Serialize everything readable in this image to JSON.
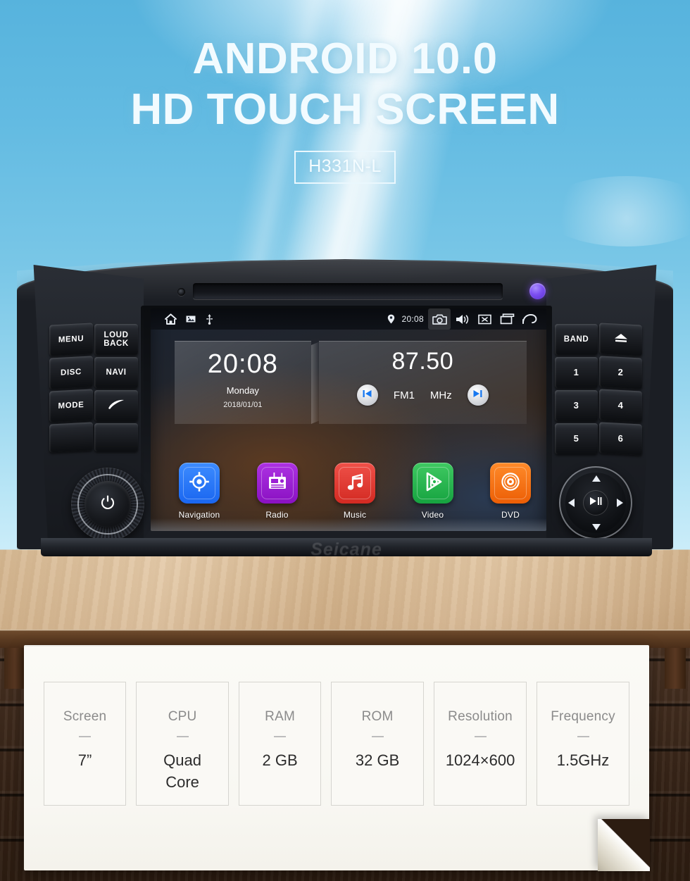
{
  "hero": {
    "line1": "ANDROID 10.0",
    "line2": "HD TOUCH SCREEN",
    "model_badge": "H331N-L"
  },
  "device": {
    "brand": "Seicane",
    "left_buttons": [
      {
        "label": "MENU",
        "name": "menu-button"
      },
      {
        "label": "LOUD\nBACK",
        "name": "loud-back-button"
      },
      {
        "label": "DISC",
        "name": "disc-button"
      },
      {
        "label": "NAVI",
        "name": "navi-button"
      },
      {
        "label": "MODE",
        "name": "mode-button"
      },
      {
        "label": "",
        "name": "phone-button"
      },
      {
        "label": "",
        "name": "blank-button-1"
      },
      {
        "label": "",
        "name": "blank-button-2"
      }
    ],
    "right_buttons": [
      {
        "label": "BAND",
        "name": "band-button"
      },
      {
        "label": "",
        "name": "eject-button"
      },
      {
        "label": "1",
        "name": "preset-1-button"
      },
      {
        "label": "2",
        "name": "preset-2-button"
      },
      {
        "label": "3",
        "name": "preset-3-button"
      },
      {
        "label": "4",
        "name": "preset-4-button"
      },
      {
        "label": "5",
        "name": "preset-5-button"
      },
      {
        "label": "6",
        "name": "preset-6-button"
      }
    ],
    "knob_icon": "power-icon",
    "dpad_center_icon": "play-pause-icon"
  },
  "screen": {
    "statusbar": {
      "left_icons": [
        "home-icon",
        "gallery-icon",
        "usb-icon"
      ],
      "location_icon": "location-pin-icon",
      "time": "20:08",
      "right_icons": [
        "camera-icon",
        "volume-icon",
        "close-box-icon",
        "recents-icon",
        "back-icon"
      ],
      "active_icon": "camera-icon"
    },
    "clock_widget": {
      "time": "20:08",
      "weekday": "Monday",
      "date": "2018/01/01"
    },
    "radio_widget": {
      "frequency": "87.50",
      "band": "FM1",
      "unit": "MHz",
      "prev_icon": "skip-previous-icon",
      "next_icon": "skip-next-icon"
    },
    "apps": [
      {
        "label": "Navigation",
        "icon": "navigation-target-icon",
        "color": "#2979ff"
      },
      {
        "label": "Radio",
        "icon": "radio-icon",
        "color": "#9c1fd4"
      },
      {
        "label": "Music",
        "icon": "music-note-icon",
        "color": "#e03b33"
      },
      {
        "label": "Video",
        "icon": "video-play-icon",
        "color": "#22b24c"
      },
      {
        "label": "DVD",
        "icon": "dvd-disc-icon",
        "color": "#f26a10"
      }
    ]
  },
  "specs": [
    {
      "key": "Screen",
      "value": "7”"
    },
    {
      "key": "CPU",
      "value": "Quad\nCore"
    },
    {
      "key": "RAM",
      "value": "2 GB"
    },
    {
      "key": "ROM",
      "value": "32 GB"
    },
    {
      "key": "Resolution",
      "value": "1024×600"
    },
    {
      "key": "Frequency",
      "value": "1.5GHz"
    }
  ],
  "colors": {
    "sky": "#7ac7e7",
    "accent_badge": "#f4fcff",
    "paper": "#faf9f5",
    "led": "#7b4ef0"
  }
}
